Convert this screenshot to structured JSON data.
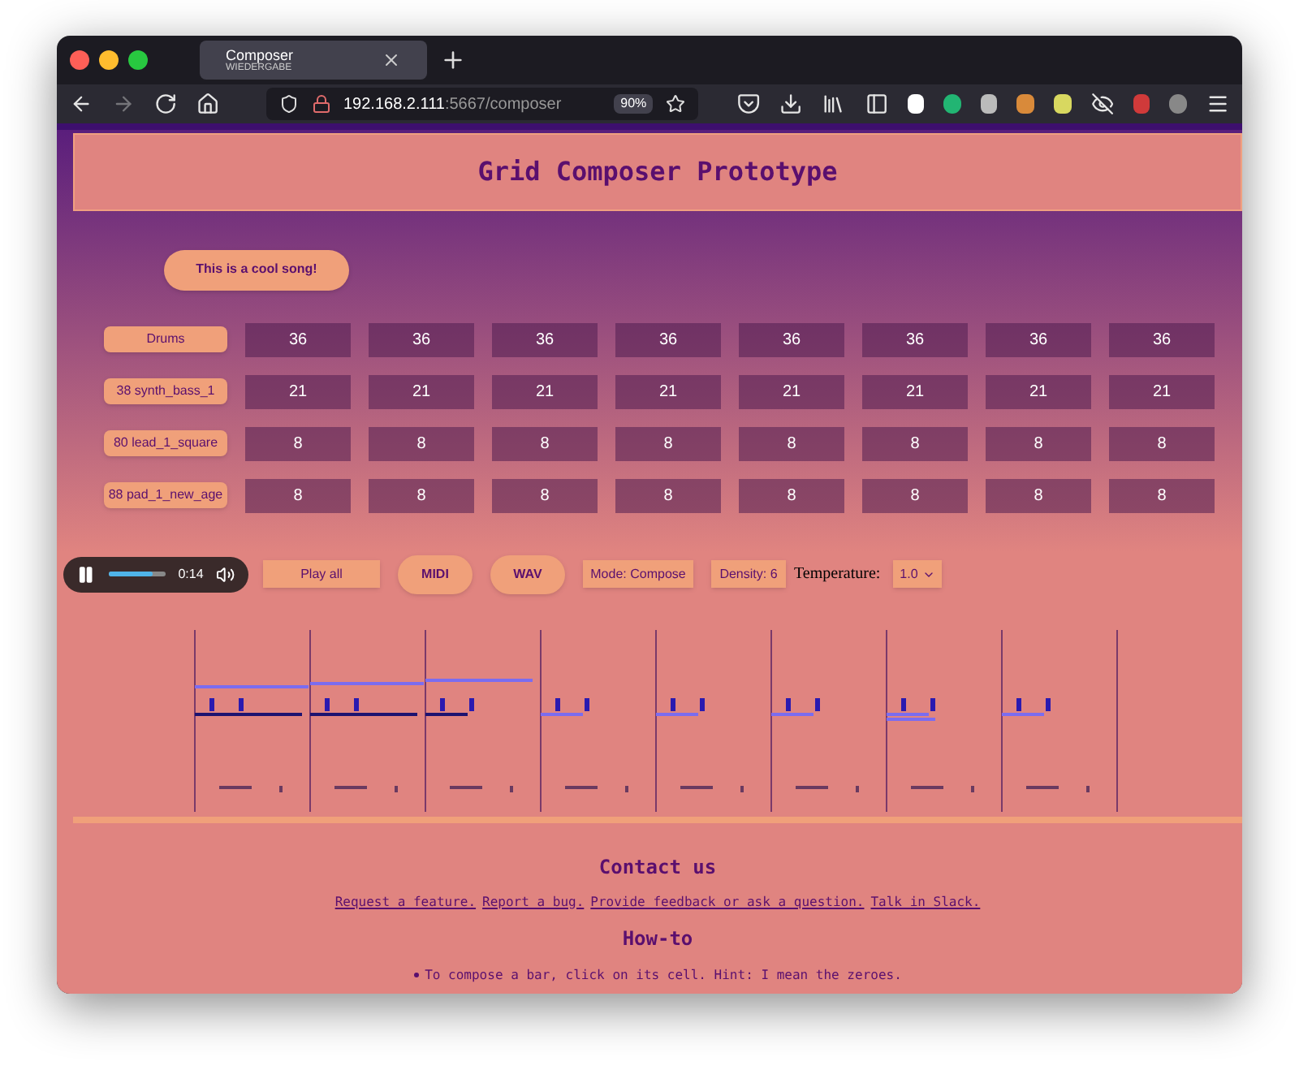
{
  "browser": {
    "tab": {
      "title": "Composer",
      "subtitle": "WIEDERGABE"
    },
    "url_host": "192.168.2.111",
    "url_rest": ":5667/composer",
    "zoom": "90%"
  },
  "header": {
    "title": "Grid Composer Prototype"
  },
  "song_button": "This is a cool song!",
  "tracks": [
    {
      "instrument": "Drums",
      "cells": [
        "36",
        "36",
        "36",
        "36",
        "36",
        "36",
        "36",
        "36"
      ]
    },
    {
      "instrument": "38 synth_bass_1",
      "cells": [
        "21",
        "21",
        "21",
        "21",
        "21",
        "21",
        "21",
        "21"
      ]
    },
    {
      "instrument": "80 lead_1_square",
      "cells": [
        "8",
        "8",
        "8",
        "8",
        "8",
        "8",
        "8",
        "8"
      ]
    },
    {
      "instrument": "88 pad_1_new_age",
      "cells": [
        "8",
        "8",
        "8",
        "8",
        "8",
        "8",
        "8",
        "8"
      ]
    }
  ],
  "player": {
    "level": 0.78,
    "time": "0:14"
  },
  "controls": {
    "play_select": "Play all",
    "midi": "MIDI",
    "wav": "WAV",
    "mode_select": "Mode: Compose",
    "density_select": "Density: 6",
    "temperature_label": "Temperature:",
    "temperature_value": "1.0"
  },
  "contact": {
    "title": "Contact us",
    "links": [
      "Request a feature.",
      "Report a bug.",
      "Provide feedback or ask a question.",
      "Talk in Slack."
    ]
  },
  "howto": {
    "title": "How-to",
    "items": [
      "To compose a bar, click on its cell. Hint: I mean the zeroes."
    ]
  }
}
